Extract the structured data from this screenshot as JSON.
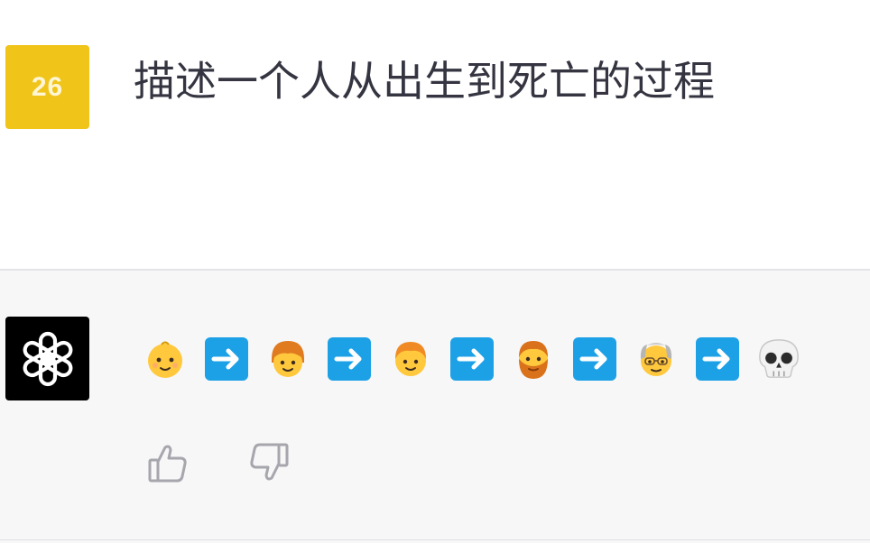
{
  "user_turn": {
    "avatar_text": "26",
    "avatar_color": "#f0c419",
    "message": "描述一个人从出生到死亡的过程"
  },
  "assistant_turn": {
    "avatar_icon": "openai-logo-icon",
    "emoji_sequence": [
      {
        "name": "baby-emoji",
        "glyph": "👶"
      },
      {
        "name": "arrow-right-emoji",
        "glyph": "➡️"
      },
      {
        "name": "child-emoji",
        "glyph": "🧒"
      },
      {
        "name": "arrow-right-emoji",
        "glyph": "➡️"
      },
      {
        "name": "person-emoji",
        "glyph": "🧑"
      },
      {
        "name": "arrow-right-emoji",
        "glyph": "➡️"
      },
      {
        "name": "bearded-person-emoji",
        "glyph": "🧔"
      },
      {
        "name": "arrow-right-emoji",
        "glyph": "➡️"
      },
      {
        "name": "old-man-emoji",
        "glyph": "👴"
      },
      {
        "name": "arrow-right-emoji",
        "glyph": "➡️"
      },
      {
        "name": "skull-emoji",
        "glyph": "💀"
      }
    ]
  },
  "feedback": {
    "thumbs_up_icon": "thumbs-up-icon",
    "thumbs_down_icon": "thumbs-down-icon"
  },
  "colors": {
    "user_bg": "#ffffff",
    "assistant_bg": "#f7f7f8",
    "text": "#343541",
    "arrow_blue": "#1da1e6"
  }
}
